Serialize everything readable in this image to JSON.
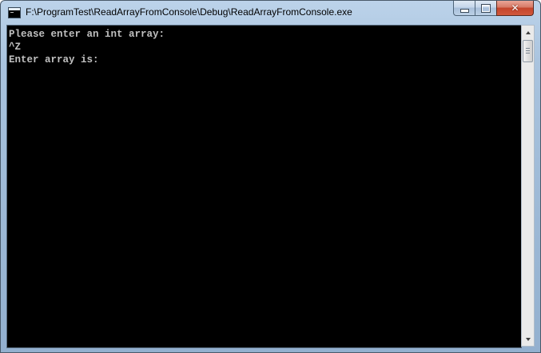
{
  "window": {
    "title": "F:\\ProgramTest\\ReadArrayFromConsole\\Debug\\ReadArrayFromConsole.exe",
    "icon": "console-app-icon",
    "close_label": "✕"
  },
  "console": {
    "lines": [
      "Please enter an int array:",
      "^Z",
      "Enter array is:"
    ],
    "background_color": "#000000",
    "text_color": "#c0c0c0"
  },
  "colors": {
    "titlebar": "#a9c3de",
    "close_button": "#c4452c"
  }
}
